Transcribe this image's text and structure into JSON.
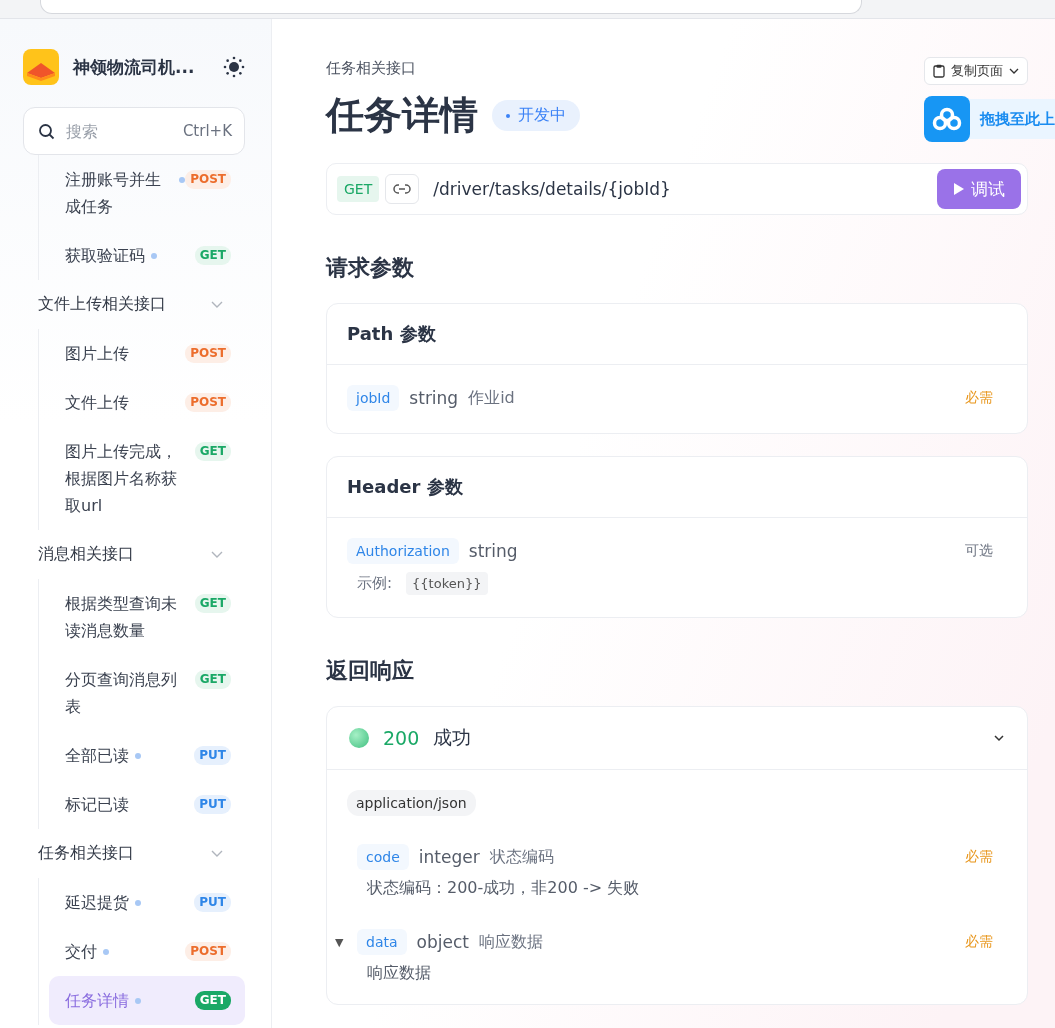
{
  "sidebar": {
    "project_name": "神领物流司机...",
    "search": {
      "placeholder": "搜索",
      "shortcut": "Ctrl+K"
    },
    "groups": [
      {
        "children": [
          {
            "label": "注册账号并生成任务",
            "method": "POST",
            "status_dot": true,
            "selected": false
          },
          {
            "label": "获取验证码",
            "method": "GET",
            "status_dot": true,
            "selected": false
          }
        ]
      },
      {
        "title": "文件上传相关接口",
        "expanded": true,
        "children": [
          {
            "label": "图片上传",
            "method": "POST",
            "status_dot": false,
            "selected": false
          },
          {
            "label": "文件上传",
            "method": "POST",
            "status_dot": false,
            "selected": false
          },
          {
            "label": "图片上传完成，根据图片名称获取url",
            "method": "GET",
            "status_dot": false,
            "selected": false
          }
        ]
      },
      {
        "title": "消息相关接口",
        "expanded": true,
        "children": [
          {
            "label": "根据类型查询未读消息数量",
            "method": "GET",
            "status_dot": false,
            "selected": false
          },
          {
            "label": "分页查询消息列表",
            "method": "GET",
            "status_dot": false,
            "selected": false
          },
          {
            "label": "全部已读",
            "method": "PUT",
            "status_dot": true,
            "selected": false
          },
          {
            "label": "标记已读",
            "method": "PUT",
            "status_dot": false,
            "selected": false
          }
        ]
      },
      {
        "title": "任务相关接口",
        "expanded": true,
        "children": [
          {
            "label": "延迟提货",
            "method": "PUT",
            "status_dot": true,
            "selected": false
          },
          {
            "label": "交付",
            "method": "POST",
            "status_dot": true,
            "selected": false
          },
          {
            "label": "任务详情",
            "method": "GET",
            "status_dot": true,
            "selected": true
          }
        ]
      }
    ]
  },
  "header": {
    "breadcrumb": "任务相关接口",
    "title": "任务详情",
    "status": "开发中",
    "copy_button": "复制页面"
  },
  "overlay": {
    "label": "拖拽至此上"
  },
  "endpoint": {
    "method": "GET",
    "path": "/driver/tasks/details/{jobId}",
    "run_button": "调试"
  },
  "request": {
    "heading": "请求参数",
    "sections": [
      {
        "title": "Path 参数",
        "params": [
          {
            "name": "jobId",
            "type": "string",
            "description": "作业id",
            "required": true,
            "required_label": "必需"
          }
        ]
      },
      {
        "title": "Header 参数",
        "params": [
          {
            "name": "Authorization",
            "type": "string",
            "required": false,
            "required_label": "可选",
            "example_label": "示例:",
            "example": "{{token}}"
          }
        ]
      }
    ]
  },
  "response": {
    "heading": "返回响应",
    "status_code": "200",
    "status_text": "成功",
    "expanded": true,
    "content_type": "application/json",
    "fields": [
      {
        "name": "code",
        "type": "integer",
        "title": "状态编码",
        "required": true,
        "required_label": "必需",
        "note": "状态编码：200-成功，非200 -> 失败"
      },
      {
        "name": "data",
        "type": "object",
        "title": "响应数据",
        "required": true,
        "required_label": "必需",
        "note": "响应数据",
        "toggle": "▼",
        "expanded": true
      }
    ]
  }
}
